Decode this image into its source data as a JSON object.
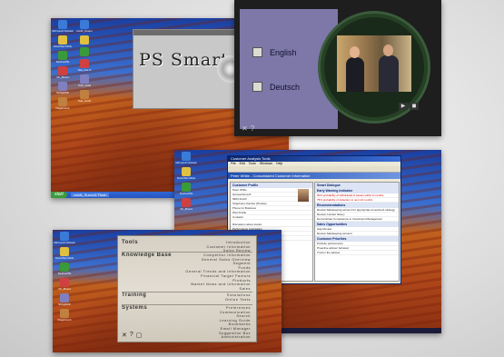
{
  "desktop": {
    "icons_a": [
      "Microsoft Outlook",
      "SmartNet MAIL",
      "FlyOverPE",
      "VF_8Cent",
      "ShSpRDP",
      "PageCount"
    ],
    "icons_b": [
      "credit_Sueno",
      "",
      "",
      "Tele_line.O",
      "TelO_sb01",
      "Tele_textO"
    ],
    "start": "start",
    "task": "credit_Sueno5 Flash"
  },
  "ps_smart": {
    "logo": "PS Smart"
  },
  "language": {
    "options": [
      "English",
      "Deutsch"
    ],
    "controls": [
      "✕",
      "?"
    ],
    "video_controls": [
      "▶",
      "◼"
    ]
  },
  "customer_tools": {
    "title": "Customer Analysis Tools",
    "menu": [
      "File",
      "Edit",
      "Tools",
      "Windows",
      "Help"
    ],
    "header": "Peter White - Consolidated Customer Information",
    "profile_title": "Customer Profile",
    "profile_rows": [
      "Peter White",
      "Hameenlinna 8",
      "9953 Zurich",
      "Telephone Number (Private)",
      "Phone for Business",
      "Pilot Profile",
      "Contacts"
    ],
    "products": [
      "Discussion about stocks",
      "Performance Calculation",
      "Balance",
      "Sundry"
    ],
    "smart_title": "Smart Dialogue",
    "indicators_title": "Early Warning Indicator",
    "indicators": [
      "60% probability of withdrawal of assets within 6 months",
      "75% probability of defection in next 12 months"
    ],
    "recs_title": "Recommendations",
    "recs": [
      "Review Safekeeping account for appropriate investment strategy",
      "Review Contact history",
      "Demonstrate Competence in Investment Management"
    ],
    "sales_title": "Sales Opportunities",
    "sales": [
      "Gap Review",
      "Review Safekeeping account"
    ],
    "cpi_title": "Customer Priorities",
    "cpi": [
      "Portfolio performance",
      "Proactive advisor behavior",
      "Trust in the advisor"
    ],
    "task": "Customer Analysis Tools"
  },
  "tools_menu": {
    "groups": [
      {
        "name": "Tools",
        "items": [
          "Introduction",
          "Customer Information",
          "Sales Review"
        ]
      },
      {
        "name": "Knowledge Base",
        "items": [
          "Competitor Information",
          "General Sales Overview",
          "Segment",
          "Funds",
          "General Trends and Information",
          "Financial Target Factors",
          "Products",
          "Market News and Information",
          "Sales"
        ]
      },
      {
        "name": "Training",
        "items": [
          "Simulations",
          "Online Tests"
        ]
      },
      {
        "name": "Systems",
        "items": [
          "Preferences",
          "Communication",
          "Search",
          "Learning Guide",
          "Bookmarks",
          "Email Manager",
          "Suggestion Box",
          "Administration"
        ]
      }
    ],
    "controls": [
      "✕",
      "?",
      "▢"
    ]
  }
}
